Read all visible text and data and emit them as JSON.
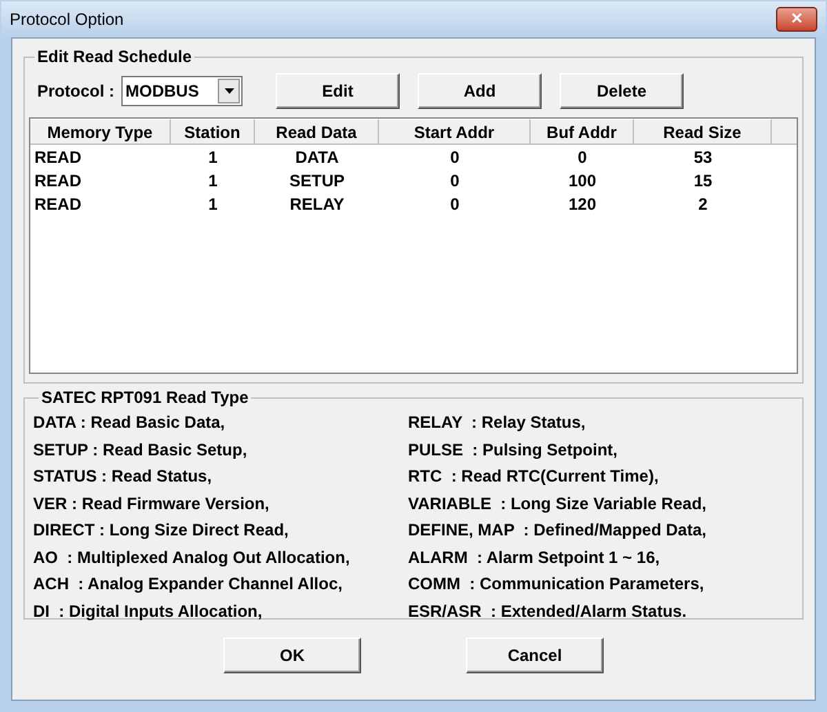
{
  "window": {
    "title": "Protocol Option",
    "close": "✕"
  },
  "schedule": {
    "legend": "Edit Read Schedule",
    "protocol_label": "Protocol :",
    "protocol_value": "MODBUS",
    "buttons": [
      "Edit",
      "Add",
      "Delete"
    ]
  },
  "table": {
    "columns": [
      "Memory Type",
      "Station",
      "Read Data",
      "Start Addr",
      "Buf Addr",
      "Read Size"
    ],
    "rows": [
      [
        "READ",
        "1",
        "DATA",
        "0",
        "0",
        "53"
      ],
      [
        "READ",
        "1",
        "SETUP",
        "0",
        "100",
        "15"
      ],
      [
        "READ",
        "1",
        "RELAY",
        "0",
        "120",
        "2"
      ]
    ]
  },
  "read_type": {
    "legend": "SATEC RPT091 Read Type",
    "left": [
      "DATA : Read Basic Data,",
      "SETUP : Read Basic Setup,",
      "STATUS : Read Status,",
      "VER : Read Firmware Version,",
      "DIRECT : Long Size Direct Read,",
      "AO  : Multiplexed Analog Out Allocation,",
      "ACH  : Analog Expander Channel Alloc,",
      "DI  : Digital Inputs Allocation,"
    ],
    "right": [
      "RELAY  : Relay Status,",
      "PULSE  : Pulsing Setpoint,",
      "RTC  : Read RTC(Current Time),",
      "VARIABLE  : Long Size Variable Read,",
      "DEFINE, MAP  : Defined/Mapped Data,",
      "ALARM  : Alarm Setpoint 1 ~ 16,",
      "COMM  : Communication Parameters,",
      "ESR/ASR  : Extended/Alarm Status."
    ]
  },
  "buttons": [
    "OK",
    "Cancel"
  ]
}
